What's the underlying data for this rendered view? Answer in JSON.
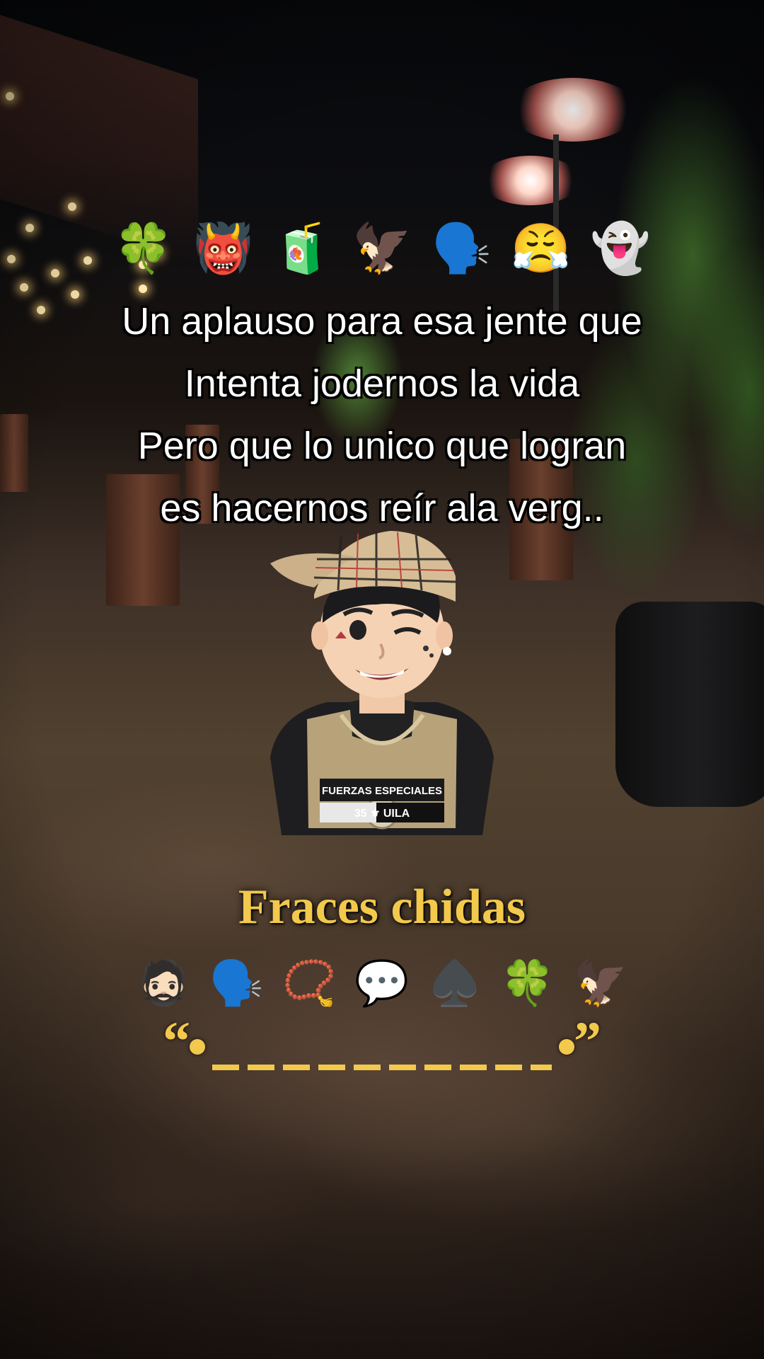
{
  "top_emojis": [
    "🍀",
    "👹",
    "🧃",
    "🦅",
    "🗣️",
    "😤",
    "👻"
  ],
  "caption_lines": [
    "Un aplauso para esa jente que",
    "Intenta jodernos la vida",
    "Pero que lo unico que logran",
    "es hacernos reír ala verg.."
  ],
  "avatar": {
    "vest_label_line1": "FUERZAS ESPECIALES",
    "vest_label_line2": "35 ⚜ UILA"
  },
  "title": "Fraces chidas",
  "bottom_emojis": [
    "🧔🏻",
    "🗣️",
    "📿",
    "💬",
    "♠️",
    "🍀",
    "🦅"
  ],
  "quote": {
    "open": "“",
    "close": "”"
  },
  "colors": {
    "title_gold": "#f2c94c",
    "caption_white": "#ffffff",
    "caption_outline": "#000000"
  }
}
